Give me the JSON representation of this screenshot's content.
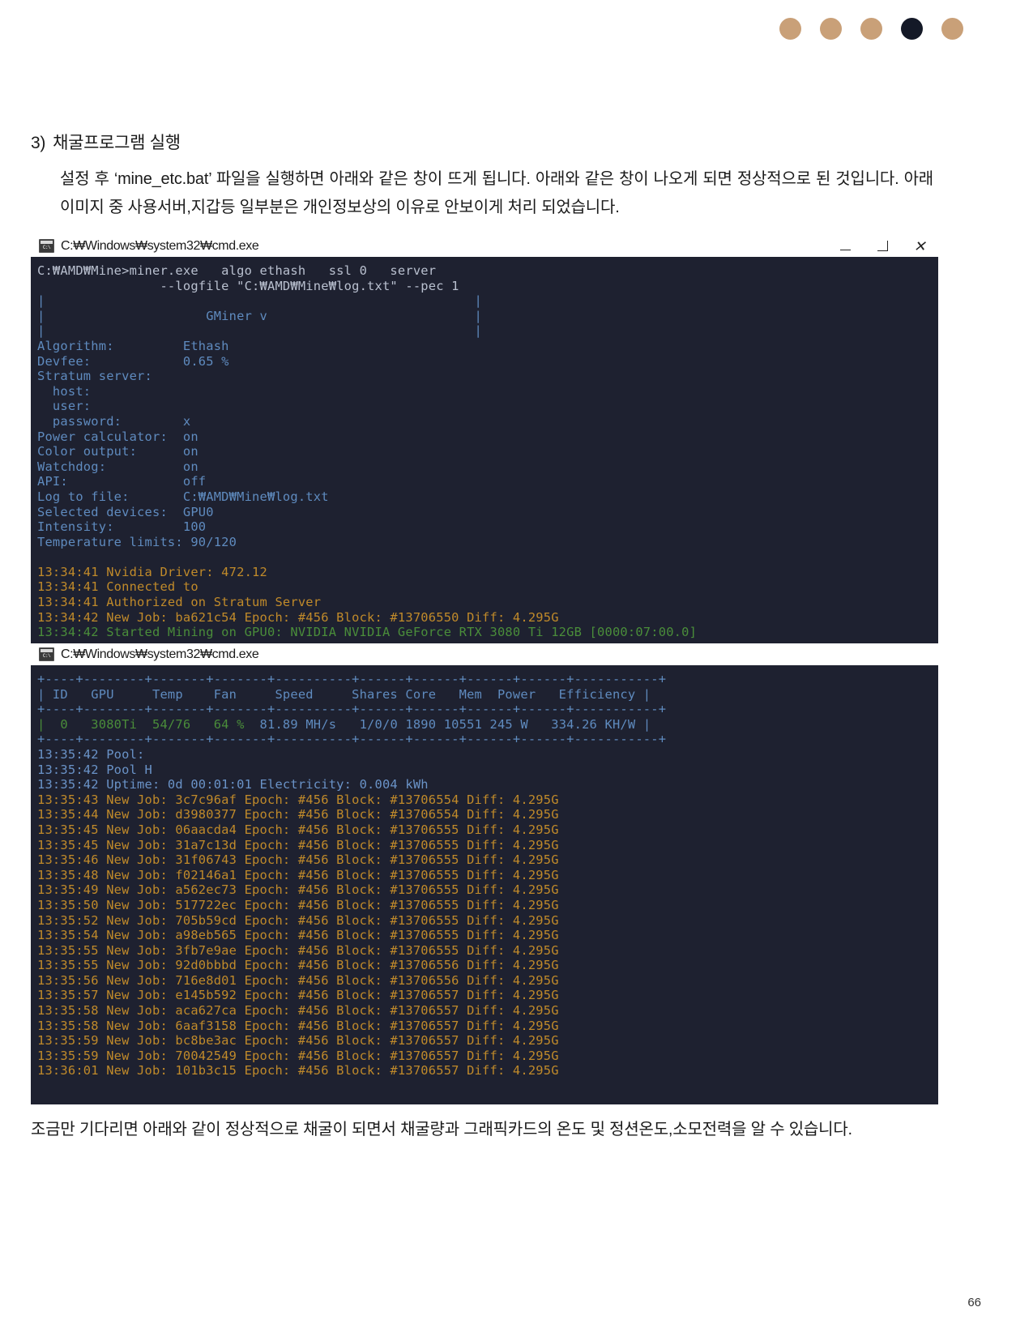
{
  "decor": {
    "dots": [
      "#c9a078",
      "#c9a078",
      "#c9a078",
      "#141927",
      "#c9a078"
    ]
  },
  "section": {
    "number": "3)",
    "heading": "채굴프로그램 실행",
    "paragraph": "설정 후 ‘mine_etc.bat’ 파일을 실행하면 아래와 같은 창이 뜨게 됩니다. 아래와 같은 창이 나오게 되면 정상적으로 된 것입니다. 아래 이미지 중 사용서버,지갑등 일부분은 개인정보상의 이유로 안보이게 처리 되었습니다.",
    "closing_paragraph": "조금만 기다리면 아래와 같이 정상적으로 채굴이 되면서 채굴량과 그래픽카드의 온도 및 정션온도,소모전력을 알 수 있습니다."
  },
  "window1": {
    "icon_label": "C:\\",
    "title": "C:₩Windows₩system32₩cmd.exe",
    "controls": {
      "minimize": "minimize-button",
      "maximize": "maximize-button",
      "close": "✕"
    },
    "lines": [
      {
        "color": "gray",
        "text": "C:₩AMD₩Mine>miner.exe   algo ethash   ssl 0   server"
      },
      {
        "color": "gray",
        "text": "                --logfile \"C:₩AMD₩Mine₩log.txt\" --pec 1"
      },
      {
        "color": "blue",
        "text": "|                                                        |"
      },
      {
        "color": "blue",
        "text": "|                     GMiner v                           |"
      },
      {
        "color": "blue",
        "text": "|                                                        |"
      },
      {
        "color": "blue",
        "text": "Algorithm:         Ethash"
      },
      {
        "color": "blue",
        "text": "Devfee:            0.65 %"
      },
      {
        "color": "blue",
        "text": "Stratum server:"
      },
      {
        "color": "blue",
        "text": "  host:"
      },
      {
        "color": "blue",
        "text": "  user:"
      },
      {
        "color": "blue",
        "text": "  password:        x"
      },
      {
        "color": "blue",
        "text": "Power calculator:  on"
      },
      {
        "color": "blue",
        "text": "Color output:      on"
      },
      {
        "color": "blue",
        "text": "Watchdog:          on"
      },
      {
        "color": "blue",
        "text": "API:               off"
      },
      {
        "color": "blue",
        "text": "Log to file:       C:₩AMD₩Mine₩log.txt"
      },
      {
        "color": "blue",
        "text": "Selected devices:  GPU0"
      },
      {
        "color": "blue",
        "text": "Intensity:         100"
      },
      {
        "color": "blue",
        "text": "Temperature limits: 90/120"
      },
      {
        "color": "blue",
        "text": ""
      },
      {
        "color": "yellow",
        "text": "13:34:41 Nvidia Driver: 472.12"
      },
      {
        "color": "yellow",
        "text": "13:34:41 Connected to"
      },
      {
        "color": "yellow",
        "text": "13:34:41 Authorized on Stratum Server"
      },
      {
        "color": "yellow",
        "text": "13:34:42 New Job: ba621c54 Epoch: #456 Block: #13706550 Diff: 4.295G"
      },
      {
        "color": "green",
        "text": "13:34:42 Started Mining on GPU0: NVIDIA NVIDIA GeForce RTX 3080 Ti 12GB [0000:07:00.0]"
      }
    ]
  },
  "window2": {
    "icon_label": "C:\\",
    "title": "C:₩Windows₩system32₩cmd.exe",
    "table": {
      "rule": "+----+--------+-------+-------+----------+------+------+------+------+-----------+",
      "headers": [
        "ID",
        "GPU",
        "Temp",
        "Fan",
        "Speed",
        "Shares",
        "Core",
        "Mem",
        "Power",
        "Efficiency"
      ],
      "header_line": "| ID   GPU     Temp    Fan     Speed     Shares Core   Mem  Power   Efficiency |",
      "row_green": "|  0   3080Ti  54/76   64 %",
      "row_blue": "  81.89 MH/s   1/0/0 1890 10551 245 W   334.26 KH/W |",
      "row_values": {
        "id": "0",
        "gpu": "3080Ti",
        "temp": "54/76",
        "fan": "64 %",
        "speed": "81.89 MH/s",
        "shares": "1/0/0",
        "core": "1890",
        "mem": "10551",
        "power": "245 W",
        "efficiency": "334.26 KH/W"
      }
    },
    "lines": [
      {
        "color": "lblue",
        "text": "13:35:42 Pool:"
      },
      {
        "color": "lblue",
        "text": "13:35:42 Pool H"
      },
      {
        "color": "lblue",
        "text": "13:35:42 Uptime: 0d 00:01:01 Electricity: 0.004 kWh"
      },
      {
        "color": "yellow",
        "text": "13:35:43 New Job: 3c7c96af Epoch: #456 Block: #13706554 Diff: 4.295G"
      },
      {
        "color": "yellow",
        "text": "13:35:44 New Job: d3980377 Epoch: #456 Block: #13706554 Diff: 4.295G"
      },
      {
        "color": "yellow",
        "text": "13:35:45 New Job: 06aacda4 Epoch: #456 Block: #13706555 Diff: 4.295G"
      },
      {
        "color": "yellow",
        "text": "13:35:45 New Job: 31a7c13d Epoch: #456 Block: #13706555 Diff: 4.295G"
      },
      {
        "color": "yellow",
        "text": "13:35:46 New Job: 31f06743 Epoch: #456 Block: #13706555 Diff: 4.295G"
      },
      {
        "color": "yellow",
        "text": "13:35:48 New Job: f02146a1 Epoch: #456 Block: #13706555 Diff: 4.295G"
      },
      {
        "color": "yellow",
        "text": "13:35:49 New Job: a562ec73 Epoch: #456 Block: #13706555 Diff: 4.295G"
      },
      {
        "color": "yellow",
        "text": "13:35:50 New Job: 517722ec Epoch: #456 Block: #13706555 Diff: 4.295G"
      },
      {
        "color": "yellow",
        "text": "13:35:52 New Job: 705b59cd Epoch: #456 Block: #13706555 Diff: 4.295G"
      },
      {
        "color": "yellow",
        "text": "13:35:54 New Job: a98eb565 Epoch: #456 Block: #13706555 Diff: 4.295G"
      },
      {
        "color": "yellow",
        "text": "13:35:55 New Job: 3fb7e9ae Epoch: #456 Block: #13706555 Diff: 4.295G"
      },
      {
        "color": "yellow",
        "text": "13:35:55 New Job: 92d0bbbd Epoch: #456 Block: #13706556 Diff: 4.295G"
      },
      {
        "color": "yellow",
        "text": "13:35:56 New Job: 716e8d01 Epoch: #456 Block: #13706556 Diff: 4.295G"
      },
      {
        "color": "yellow",
        "text": "13:35:57 New Job: e145b592 Epoch: #456 Block: #13706557 Diff: 4.295G"
      },
      {
        "color": "yellow",
        "text": "13:35:58 New Job: aca627ca Epoch: #456 Block: #13706557 Diff: 4.295G"
      },
      {
        "color": "yellow",
        "text": "13:35:58 New Job: 6aaf3158 Epoch: #456 Block: #13706557 Diff: 4.295G"
      },
      {
        "color": "yellow",
        "text": "13:35:59 New Job: bc8be3ac Epoch: #456 Block: #13706557 Diff: 4.295G"
      },
      {
        "color": "yellow",
        "text": "13:35:59 New Job: 70042549 Epoch: #456 Block: #13706557 Diff: 4.295G"
      },
      {
        "color": "yellow",
        "text": "13:36:01 New Job: 101b3c15 Epoch: #456 Block: #13706557 Diff: 4.295G"
      }
    ]
  },
  "footer": {
    "page_number": "66"
  }
}
